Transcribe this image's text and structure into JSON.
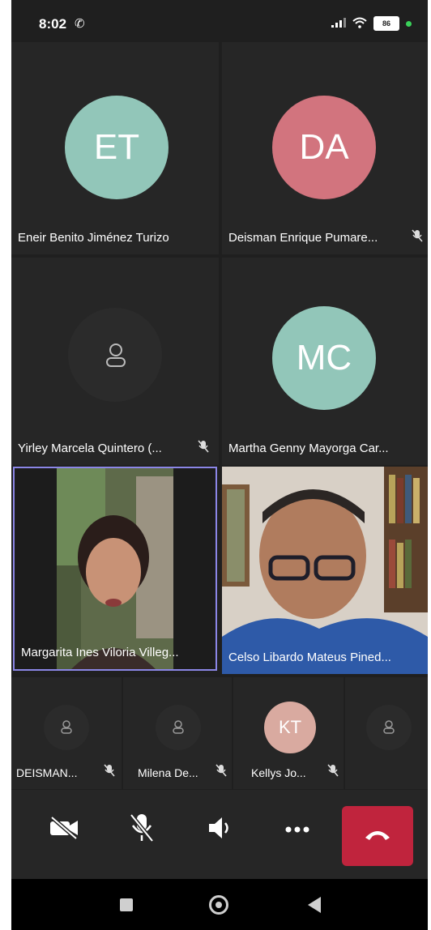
{
  "status_bar": {
    "time": "8:02",
    "battery": "86"
  },
  "participants": [
    {
      "initials": "ET",
      "name": "Eneir Benito Jiménez Turizo",
      "avatar_color": "#92c6b9",
      "muted": false
    },
    {
      "initials": "DA",
      "name": "Deisman Enrique Pumare...",
      "avatar_color": "#d2747e",
      "muted": true
    },
    {
      "initials": "",
      "name": "Yirley Marcela Quintero (...",
      "avatar_color": "#2b2b2b",
      "muted": true
    },
    {
      "initials": "MC",
      "name": "Martha Genny Mayorga Car...",
      "avatar_color": "#92c6b9",
      "muted": false
    },
    {
      "initials": "",
      "name": "Margarita Ines Viloria Villeg...",
      "video": true,
      "active_speaker": true,
      "muted": false
    },
    {
      "initials": "",
      "name": "Celso Libardo Mateus Pined...",
      "video": true,
      "muted": false
    },
    {
      "initials": "",
      "name": "DEISMAN...",
      "muted": true
    },
    {
      "initials": "",
      "name": "Milena De...",
      "muted": true
    },
    {
      "initials": "KT",
      "name": "Kellys Jo...",
      "avatar_color": "#d9aaa0",
      "muted": true
    },
    {
      "initials": "",
      "name": "",
      "muted": false
    }
  ],
  "controls": {
    "camera": "camera-off-icon",
    "microphone": "mic-off-icon",
    "speaker": "speaker-icon",
    "more": "more-icon",
    "hangup": "hang-up-icon",
    "hangup_color": "#c0243d"
  },
  "accent_color": "#8b86e6"
}
